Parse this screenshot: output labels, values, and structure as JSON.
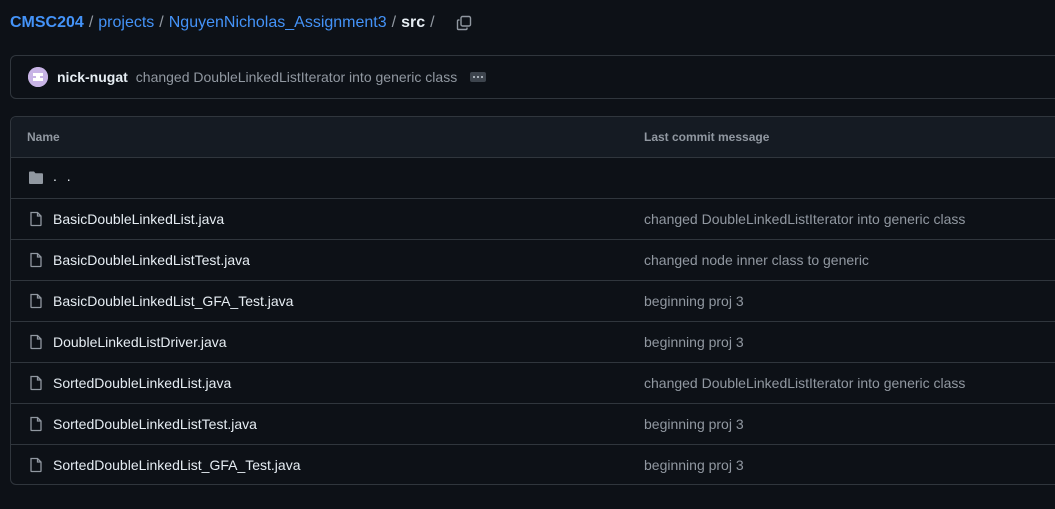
{
  "breadcrumb": {
    "repo": "CMSC204",
    "sep": "/",
    "parts": [
      "projects",
      "NguyenNicholas_Assignment3"
    ],
    "current": "src"
  },
  "icons": {
    "copy": "copy-icon",
    "folder": "folder-icon",
    "file": "file-icon"
  },
  "commit": {
    "author": "nick-nugat",
    "message": "changed DoubleLinkedListIterator into generic class"
  },
  "table": {
    "headers": {
      "name": "Name",
      "message": "Last commit message"
    },
    "parent_label": ". .",
    "files": [
      {
        "name": "BasicDoubleLinkedList.java",
        "message": "changed DoubleLinkedListIterator into generic class"
      },
      {
        "name": "BasicDoubleLinkedListTest.java",
        "message": "changed node inner class to generic"
      },
      {
        "name": "BasicDoubleLinkedList_GFA_Test.java",
        "message": "beginning proj 3"
      },
      {
        "name": "DoubleLinkedListDriver.java",
        "message": "beginning proj 3"
      },
      {
        "name": "SortedDoubleLinkedList.java",
        "message": "changed DoubleLinkedListIterator into generic class"
      },
      {
        "name": "SortedDoubleLinkedListTest.java",
        "message": "beginning proj 3"
      },
      {
        "name": "SortedDoubleLinkedList_GFA_Test.java",
        "message": "beginning proj 3"
      }
    ]
  },
  "colors": {
    "background": "#0d1117",
    "link": "#4493f8",
    "muted": "#9198a1",
    "border": "#30363d"
  }
}
